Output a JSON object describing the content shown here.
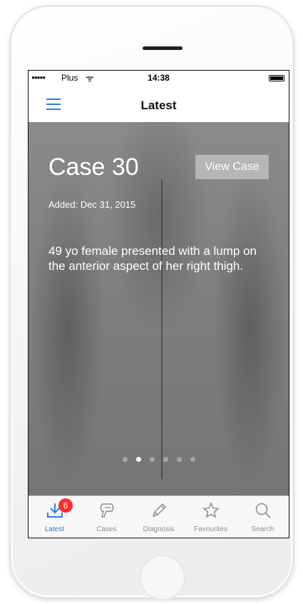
{
  "status_bar": {
    "signal": "●●●●●",
    "carrier": "Plus",
    "wifi": "ᯤ",
    "time": "14:38"
  },
  "nav": {
    "title": "Latest",
    "menu_icon": "hamburger-menu-icon"
  },
  "case": {
    "title": "Case 30",
    "view_button": "View Case",
    "added": "Added: Dec 31, 2015",
    "description": "49 yo female presented with a lump on the anterior aspect of her right thigh."
  },
  "pager": {
    "count": 6,
    "active_index": 1
  },
  "tabs": [
    {
      "label": "Latest",
      "icon": "download-icon",
      "badge": "6",
      "active": true
    },
    {
      "label": "Cases",
      "icon": "cases-icon",
      "active": false
    },
    {
      "label": "Diagnosis",
      "icon": "pencil-icon",
      "active": false
    },
    {
      "label": "Favourites",
      "icon": "star-icon",
      "active": false
    },
    {
      "label": "Search",
      "icon": "search-icon",
      "active": false
    }
  ],
  "colors": {
    "accent": "#2d7be8",
    "badge": "#ff2d2d",
    "inactive": "#8e8e93"
  }
}
